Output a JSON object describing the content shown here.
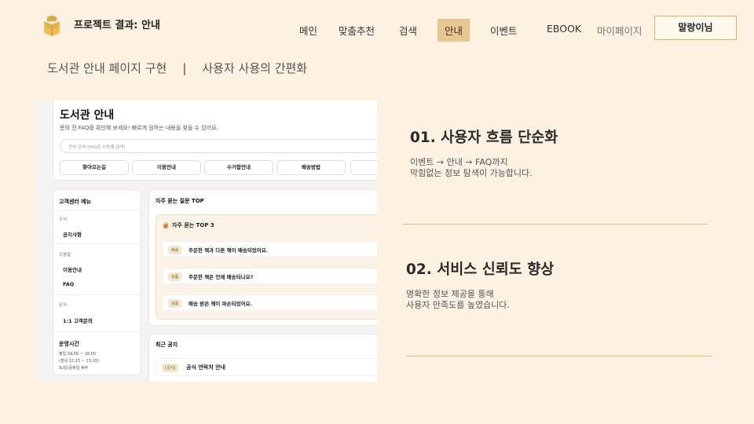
{
  "header": {
    "brand": "프로젝트 결과: 안내",
    "nav": [
      {
        "label": "메인"
      },
      {
        "label": "맞춤추천"
      },
      {
        "label": "검색"
      },
      {
        "label": "안내",
        "active": true
      },
      {
        "label": "이벤트"
      },
      {
        "label": "EBOOK"
      },
      {
        "label": "마이페이지"
      }
    ],
    "login_label": "말랑이님"
  },
  "subtitle": {
    "left": "도서관 안내 페이지 구현",
    "sep": "|",
    "right": "사용자 사용의 간편화"
  },
  "screenshot": {
    "page_title": "도서관 안내",
    "page_desc": "문의 전 FAQ를 확인해 보세요! 빠르게 원하는 내용을 찾을 수 있어요.",
    "search_placeholder": "전체 검색 (FAQ로 이동해 검색)",
    "quick_buttons": [
      "찾아오는길",
      "이용안내",
      "수거함안내",
      "배송방법",
      "배"
    ],
    "sidebar": {
      "title": "고객센터 메뉴",
      "groups": [
        {
          "label": "소식",
          "links": [
            "공지사항"
          ]
        },
        {
          "label": "도움말",
          "links": [
            "이용안내",
            "FAQ"
          ]
        },
        {
          "label": "문의",
          "links": [
            "1:1 고객문의"
          ]
        }
      ],
      "hours_title": "운영시간",
      "hours_lines": [
        "평일 09:00 ~ 18:00",
        "(점심 12:15 ~ 13:15)",
        "토/일/공휴일 휴무"
      ]
    },
    "faq": {
      "title": "자주 묻는 질문 TOP",
      "top3_title": "자주 묻는 TOP 3",
      "items": [
        {
          "badge": "배송",
          "question": "주문한 책과 다른 책이 배송되었어요."
        },
        {
          "badge": "상품",
          "question": "주문한 책은 언제 배송되나요?"
        },
        {
          "badge": "상품",
          "question": "배송 받은 책이 파손되었어요."
        }
      ]
    },
    "notice": {
      "title": "최근 공지",
      "items": [
        {
          "badge": "[공지]",
          "title": "공식 연락처 안내"
        }
      ]
    }
  },
  "features": [
    {
      "title": "01. 사용자 흐름 단순화",
      "lines": [
        "이벤트 → 안내 → FAQ까지",
        "막힘없는 정보 탐색이 가능합니다."
      ]
    },
    {
      "title": "02. 서비스 신뢰도 향상",
      "lines": [
        "명확한 정보 제공을 통해",
        "사용자 만족도를 높였습니다."
      ]
    }
  ],
  "colors": {
    "background": "#fdf1e2",
    "accent": "#e4b96a",
    "active_nav": "#e8c690"
  },
  "icons": {
    "logo": "book-box-icon",
    "top3": "fire-icon"
  }
}
